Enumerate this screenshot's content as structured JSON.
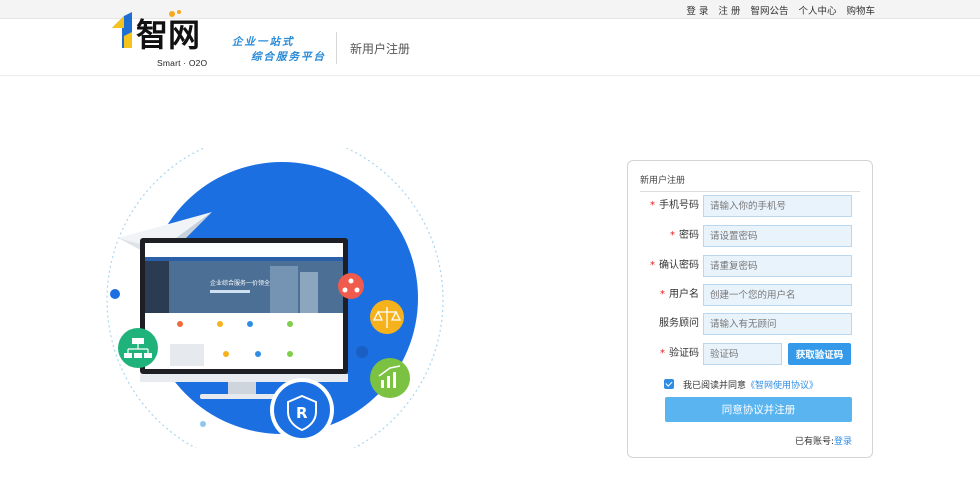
{
  "topbar": {
    "links": [
      "登 录",
      "注 册",
      "智网公告",
      "个人中心",
      "购物车"
    ]
  },
  "header": {
    "logo_text": "智网",
    "logo_sub": "Smart · O2O",
    "slogan_line1": "企业一站式",
    "slogan_line2": "综合服务平台",
    "page_title": "新用户注册"
  },
  "colors": {
    "accent": "#2f8de4",
    "button": "#3399e8",
    "submit": "#5ab4f0",
    "input_bg": "#e9f3fc",
    "required": "#e02020"
  },
  "illustration": {
    "screen_headline": "企业综合服务一价领全",
    "registered_mark": "R"
  },
  "form": {
    "heading": "新用户注册",
    "fields": [
      {
        "label": "手机号码",
        "required": true,
        "placeholder": "请输入你的手机号"
      },
      {
        "label": "密码",
        "required": true,
        "placeholder": "请设置密码"
      },
      {
        "label": "确认密码",
        "required": true,
        "placeholder": "请重复密码"
      },
      {
        "label": "用户名",
        "required": true,
        "placeholder": "创建一个您的用户名"
      },
      {
        "label": "服务顾问",
        "required": false,
        "placeholder": "请输入有无顾问"
      },
      {
        "label": "验证码",
        "required": true,
        "placeholder": "验证码"
      }
    ],
    "required_mark": "*",
    "code_button": "获取验证码",
    "agree_text": "我已阅读并同意",
    "agree_link": "《智网使用协议》",
    "agree_checked": true,
    "submit_label": "同意协议并注册",
    "login_prompt": "已有账号:",
    "login_link": "登录"
  }
}
